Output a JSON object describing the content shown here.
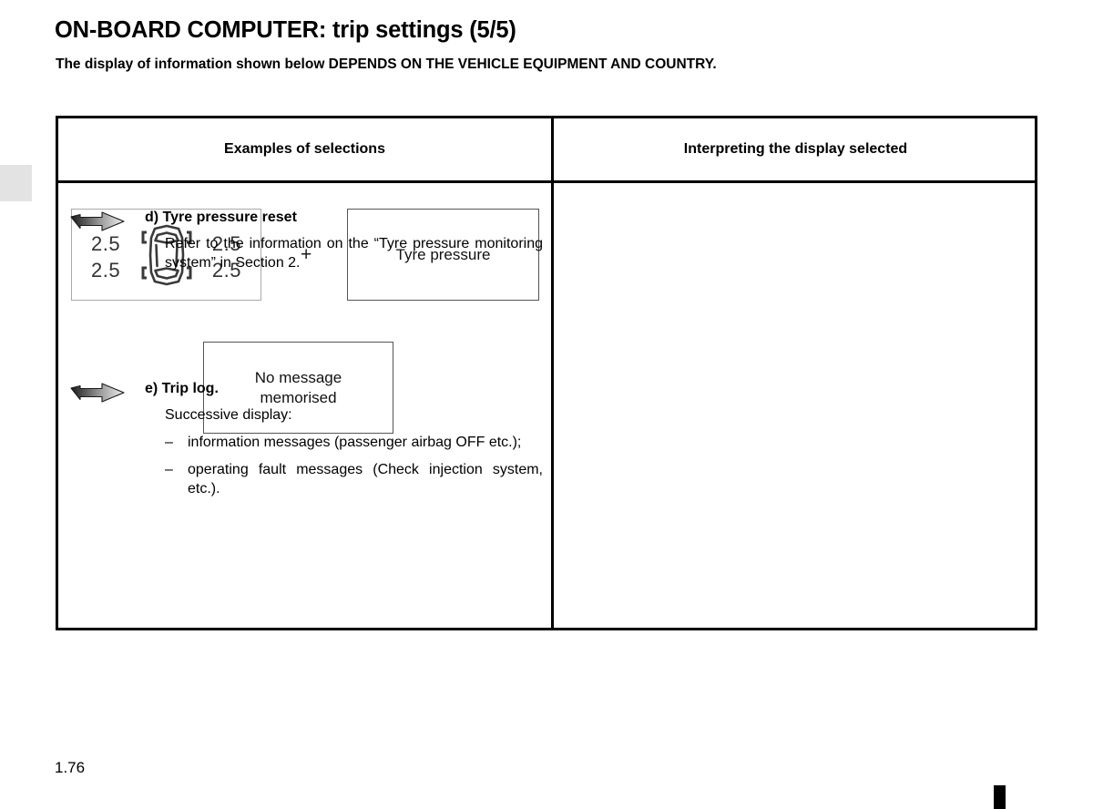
{
  "page": {
    "title": "ON-BOARD COMPUTER: trip settings (5/5)",
    "subtitle": "The display of information shown below DEPENDS ON THE VEHICLE EQUIPMENT AND COUNTRY.",
    "folio": "1.76"
  },
  "table": {
    "headers": {
      "left": "Examples of selections",
      "right": "Interpreting the display selected"
    }
  },
  "selections": {
    "tyre_display": {
      "front_left": "2.5",
      "rear_left": "2.5",
      "front_right": "2.5",
      "rear_right": "2.5",
      "icon": "car-top-view-icon"
    },
    "plus": "+",
    "tyre_pressure_box": "Tyre pressure",
    "no_message_box_line1": "No message",
    "no_message_box_line2": "memorised"
  },
  "interpretations": [
    {
      "arrow": "arrow-right-icon",
      "title": "d) Tyre pressure reset",
      "paragraph": "Refer to the information on the “Tyre pressure monitoring system” in Section 2.",
      "bullets": []
    },
    {
      "arrow": "arrow-right-icon",
      "title": "e) Trip log.",
      "paragraph": "Successive display:",
      "bullets": [
        "information messages (passenger airbag OFF etc.);",
        "operating fault messages (Check injection system, etc.)."
      ],
      "bullet_marker": "–"
    }
  ],
  "colors": {
    "border": "#000000",
    "box_border_gray": "#a8a8a8",
    "box_border_dark": "#555555",
    "tyre_value_text": "#333333",
    "edge_tab": "#e3e3e3"
  }
}
